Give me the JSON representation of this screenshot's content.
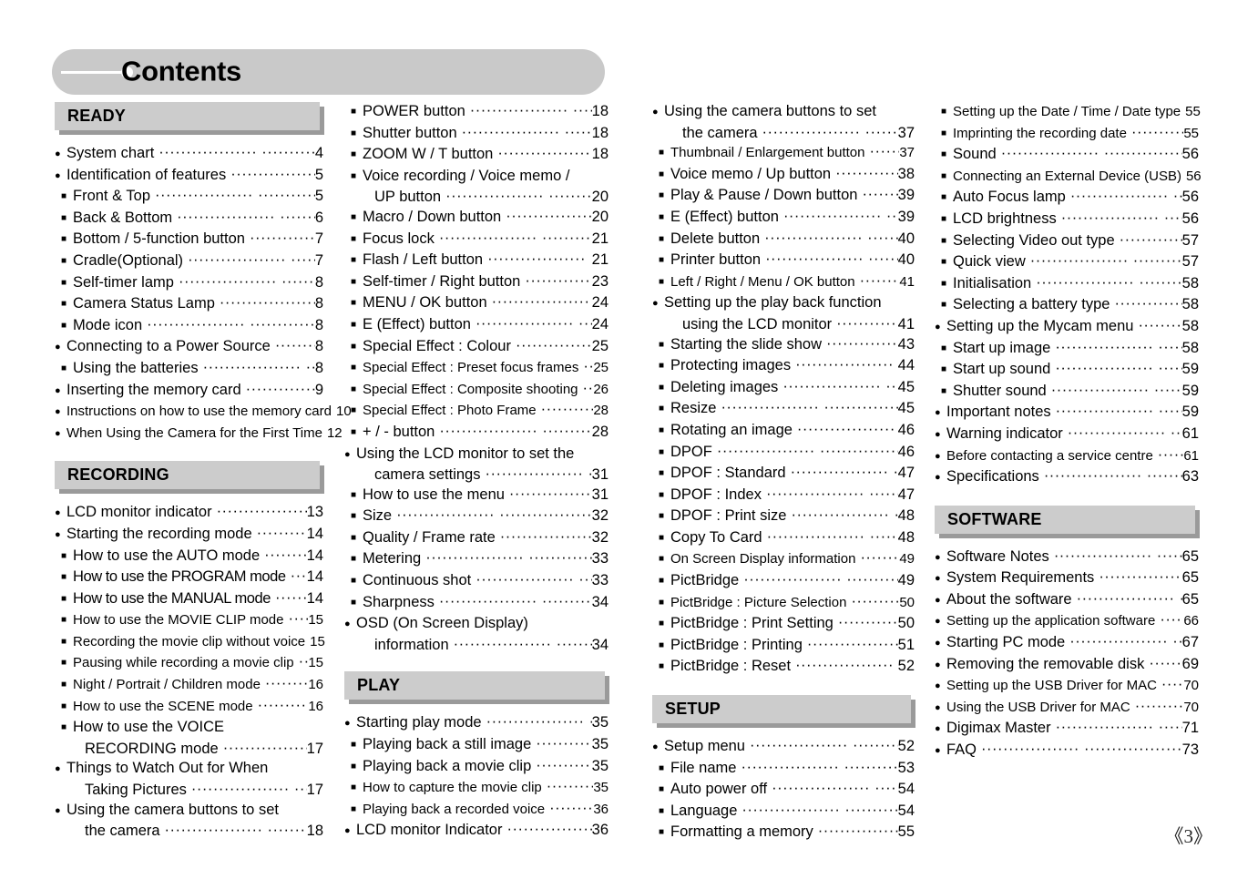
{
  "page": {
    "title": "Contents",
    "page_number": "《3》"
  },
  "columns": [
    {
      "name": "column-1",
      "blocks": [
        {
          "type": "section",
          "label": "READY"
        },
        {
          "type": "list",
          "entries": [
            {
              "level": 1,
              "text": "System chart",
              "page": "4"
            },
            {
              "level": 1,
              "text": "Identification of features",
              "page": "5"
            },
            {
              "level": 2,
              "text": "Front & Top",
              "page": "5"
            },
            {
              "level": 2,
              "text": "Back & Bottom",
              "page": "6"
            },
            {
              "level": 2,
              "text": "Bottom / 5-function button",
              "page": "7"
            },
            {
              "level": 2,
              "text": "Cradle(Optional)",
              "page": "7"
            },
            {
              "level": 2,
              "text": "Self-timer lamp",
              "page": "8"
            },
            {
              "level": 2,
              "text": "Camera Status Lamp",
              "page": "8"
            },
            {
              "level": 2,
              "text": "Mode icon",
              "page": "8"
            },
            {
              "level": 1,
              "text": "Connecting to a Power Source",
              "page": "8"
            },
            {
              "level": 2,
              "text": "Using the batteries",
              "page": "8"
            },
            {
              "level": 1,
              "text": "Inserting the memory card",
              "page": "9"
            },
            {
              "level": 1,
              "text": "Instructions on how to use the memory card",
              "page": "10",
              "narrow": true
            },
            {
              "level": 1,
              "text": "When Using the Camera for the First Time",
              "page": "12",
              "narrow": true
            }
          ]
        },
        {
          "type": "section",
          "label": "RECORDING"
        },
        {
          "type": "list",
          "entries": [
            {
              "level": 1,
              "text": "LCD monitor indicator",
              "page": "13"
            },
            {
              "level": 1,
              "text": "Starting the recording mode",
              "page": "14"
            },
            {
              "level": 2,
              "text": "How to use the AUTO mode",
              "page": "14"
            },
            {
              "level": 2,
              "text": "How to use the PROGRAM mode",
              "page": "14",
              "tight": true
            },
            {
              "level": 2,
              "text": "How to use the MANUAL mode",
              "page": "14",
              "tight": true
            },
            {
              "level": 2,
              "text": "How to use the MOVIE CLIP mode",
              "page": "15",
              "narrow": true
            },
            {
              "level": 2,
              "text": "Recording the movie clip without voice",
              "page": "15",
              "narrow": true
            },
            {
              "level": 2,
              "text": "Pausing while recording a movie clip",
              "page": "15",
              "narrow": true
            },
            {
              "level": 2,
              "text": "Night / Portrait / Children mode",
              "page": "16",
              "narrow": true
            },
            {
              "level": 2,
              "text": "How to use the SCENE mode",
              "page": "16",
              "narrow": true
            },
            {
              "level": 2,
              "text": "How to use the VOICE",
              "page": ""
            },
            {
              "level": 0,
              "text": "RECORDING mode",
              "page": "17",
              "cont": true
            },
            {
              "level": 1,
              "text": "Things to Watch Out for When",
              "page": ""
            },
            {
              "level": 0,
              "text": "Taking Pictures",
              "page": "17",
              "cont": true
            },
            {
              "level": 1,
              "text": "Using the camera buttons to set",
              "page": ""
            },
            {
              "level": 0,
              "text": "the camera",
              "page": "18",
              "cont": true
            }
          ]
        }
      ]
    },
    {
      "name": "column-2",
      "blocks": [
        {
          "type": "list",
          "entries": [
            {
              "level": 2,
              "text": "POWER button",
              "page": "18"
            },
            {
              "level": 2,
              "text": "Shutter button",
              "page": "18"
            },
            {
              "level": 2,
              "text": "ZOOM W / T button",
              "page": "18"
            },
            {
              "level": 2,
              "text": "Voice recording / Voice memo /",
              "page": ""
            },
            {
              "level": 0,
              "text": "UP button",
              "page": "20",
              "cont": true
            },
            {
              "level": 2,
              "text": "Macro / Down button",
              "page": "20"
            },
            {
              "level": 2,
              "text": "Focus lock",
              "page": "21"
            },
            {
              "level": 2,
              "text": "Flash / Left button",
              "page": "21"
            },
            {
              "level": 2,
              "text": "Self-timer / Right button",
              "page": "23"
            },
            {
              "level": 2,
              "text": "MENU / OK button",
              "page": "24"
            },
            {
              "level": 2,
              "text": "E (Effect) button",
              "page": "24"
            },
            {
              "level": 2,
              "text": "Special Effect : Colour",
              "page": "25"
            },
            {
              "level": 2,
              "text": "Special Effect : Preset focus frames",
              "page": "25",
              "narrow": true
            },
            {
              "level": 2,
              "text": "Special Effect : Composite shooting",
              "page": "26",
              "narrow": true
            },
            {
              "level": 2,
              "text": "Special Effect : Photo Frame",
              "page": "28",
              "narrow": true
            },
            {
              "level": 2,
              "text": "+ / - button",
              "page": "28"
            },
            {
              "level": 1,
              "text": "Using the LCD monitor to set the",
              "page": ""
            },
            {
              "level": 0,
              "text": "camera settings",
              "page": "31",
              "cont": true
            },
            {
              "level": 2,
              "text": "How to use the menu",
              "page": "31"
            },
            {
              "level": 2,
              "text": "Size",
              "page": "32"
            },
            {
              "level": 2,
              "text": "Quality / Frame rate",
              "page": "32"
            },
            {
              "level": 2,
              "text": "Metering",
              "page": "33"
            },
            {
              "level": 2,
              "text": "Continuous shot",
              "page": "33"
            },
            {
              "level": 2,
              "text": "Sharpness",
              "page": "34"
            },
            {
              "level": 1,
              "text": "OSD (On Screen Display)",
              "page": ""
            },
            {
              "level": 0,
              "text": "information",
              "page": "34",
              "cont": true
            }
          ]
        },
        {
          "type": "section",
          "label": "PLAY"
        },
        {
          "type": "list",
          "entries": [
            {
              "level": 1,
              "text": "Starting play mode",
              "page": "35"
            },
            {
              "level": 2,
              "text": "Playing back a still image",
              "page": "35"
            },
            {
              "level": 2,
              "text": "Playing back a movie clip",
              "page": "35"
            },
            {
              "level": 2,
              "text": "How to capture the movie clip",
              "page": "35",
              "narrow": true
            },
            {
              "level": 2,
              "text": "Playing back a recorded voice",
              "page": "36",
              "narrow": true
            },
            {
              "level": 1,
              "text": "LCD  monitor Indicator",
              "page": "36"
            }
          ]
        }
      ]
    },
    {
      "name": "column-3",
      "blocks": [
        {
          "type": "list",
          "entries": [
            {
              "level": 1,
              "text": "Using the camera buttons to set",
              "page": ""
            },
            {
              "level": 0,
              "text": "the camera",
              "page": "37",
              "cont": true
            },
            {
              "level": 2,
              "text": "Thumbnail / Enlargement button",
              "page": "37",
              "narrow": true
            },
            {
              "level": 2,
              "text": "Voice memo / Up button",
              "page": "38"
            },
            {
              "level": 2,
              "text": "Play & Pause / Down button",
              "page": "39"
            },
            {
              "level": 2,
              "text": "E (Effect) button",
              "page": "39"
            },
            {
              "level": 2,
              "text": "Delete button",
              "page": "40"
            },
            {
              "level": 2,
              "text": "Printer button",
              "page": "40"
            },
            {
              "level": 2,
              "text": "Left / Right / Menu / OK button",
              "page": "41",
              "narrow": true
            },
            {
              "level": 1,
              "text": "Setting up the play back function",
              "page": ""
            },
            {
              "level": 0,
              "text": "using the LCD monitor",
              "page": "41",
              "cont": true
            },
            {
              "level": 2,
              "text": "Starting the slide show",
              "page": "43"
            },
            {
              "level": 2,
              "text": "Protecting images",
              "page": "44"
            },
            {
              "level": 2,
              "text": "Deleting images",
              "page": "45"
            },
            {
              "level": 2,
              "text": "Resize",
              "page": "45"
            },
            {
              "level": 2,
              "text": "Rotating an image",
              "page": "46"
            },
            {
              "level": 2,
              "text": "DPOF",
              "page": "46"
            },
            {
              "level": 2,
              "text": "DPOF : Standard",
              "page": "47"
            },
            {
              "level": 2,
              "text": "DPOF : Index",
              "page": "47"
            },
            {
              "level": 2,
              "text": "DPOF : Print size",
              "page": "48"
            },
            {
              "level": 2,
              "text": "Copy To Card",
              "page": "48"
            },
            {
              "level": 2,
              "text": "On Screen Display information",
              "page": "49",
              "narrow": true
            },
            {
              "level": 2,
              "text": "PictBridge",
              "page": "49"
            },
            {
              "level": 2,
              "text": "PictBridge : Picture Selection",
              "page": "50",
              "narrow": true
            },
            {
              "level": 2,
              "text": "PictBridge : Print Setting",
              "page": "50"
            },
            {
              "level": 2,
              "text": "PictBridge : Printing",
              "page": "51"
            },
            {
              "level": 2,
              "text": "PictBridge : Reset",
              "page": "52"
            }
          ]
        },
        {
          "type": "section",
          "label": "SETUP"
        },
        {
          "type": "list",
          "entries": [
            {
              "level": 1,
              "text": "Setup menu",
              "page": "52"
            },
            {
              "level": 2,
              "text": "File name",
              "page": "53"
            },
            {
              "level": 2,
              "text": "Auto power off",
              "page": "54"
            },
            {
              "level": 2,
              "text": "Language",
              "page": "54"
            },
            {
              "level": 2,
              "text": "Formatting a memory",
              "page": "55"
            }
          ]
        }
      ]
    },
    {
      "name": "column-4",
      "blocks": [
        {
          "type": "list",
          "entries": [
            {
              "level": 2,
              "text": "Setting up the Date / Time / Date type",
              "page": "55",
              "narrow": true
            },
            {
              "level": 2,
              "text": "Imprinting the recording date",
              "page": "55",
              "narrow": true
            },
            {
              "level": 2,
              "text": "Sound",
              "page": "56"
            },
            {
              "level": 2,
              "text": "Connecting an External Device (USB)",
              "page": "56",
              "narrow": true
            },
            {
              "level": 2,
              "text": "Auto Focus lamp",
              "page": "56"
            },
            {
              "level": 2,
              "text": "LCD brightness",
              "page": "56"
            },
            {
              "level": 2,
              "text": "Selecting Video out type",
              "page": "57"
            },
            {
              "level": 2,
              "text": "Quick view",
              "page": "57"
            },
            {
              "level": 2,
              "text": "Initialisation",
              "page": "58"
            },
            {
              "level": 2,
              "text": "Selecting a battery type",
              "page": "58"
            },
            {
              "level": 1,
              "text": "Setting up the Mycam menu",
              "page": "58"
            },
            {
              "level": 2,
              "text": "Start up image",
              "page": "58"
            },
            {
              "level": 2,
              "text": "Start up sound",
              "page": "59"
            },
            {
              "level": 2,
              "text": "Shutter sound",
              "page": "59"
            },
            {
              "level": 1,
              "text": "Important notes",
              "page": "59"
            },
            {
              "level": 1,
              "text": "Warning indicator",
              "page": "61"
            },
            {
              "level": 1,
              "text": "Before contacting a service centre",
              "page": "61",
              "narrow": true
            },
            {
              "level": 1,
              "text": "Specifications",
              "page": "63"
            }
          ]
        },
        {
          "type": "section",
          "label": "SOFTWARE"
        },
        {
          "type": "list",
          "entries": [
            {
              "level": 1,
              "text": "Software Notes",
              "page": "65"
            },
            {
              "level": 1,
              "text": "System Requirements",
              "page": "65"
            },
            {
              "level": 1,
              "text": "About the software",
              "page": "65"
            },
            {
              "level": 1,
              "text": "Setting up the application software",
              "page": "66",
              "narrow": true
            },
            {
              "level": 1,
              "text": "Starting PC mode",
              "page": "67"
            },
            {
              "level": 1,
              "text": "Removing the removable disk",
              "page": "69"
            },
            {
              "level": 1,
              "text": "Setting up the USB Driver for MAC",
              "page": "70",
              "narrow": true
            },
            {
              "level": 1,
              "text": "Using the USB Driver for MAC",
              "page": "70",
              "narrow": true
            },
            {
              "level": 1,
              "text": "Digimax Master",
              "page": "71"
            },
            {
              "level": 1,
              "text": "FAQ",
              "page": "73"
            }
          ]
        }
      ]
    }
  ],
  "colors": {
    "banner": "#c9c9c9",
    "section_face": "#cccccc",
    "section_shadow": "#9a9a9a",
    "text": "#000000"
  }
}
